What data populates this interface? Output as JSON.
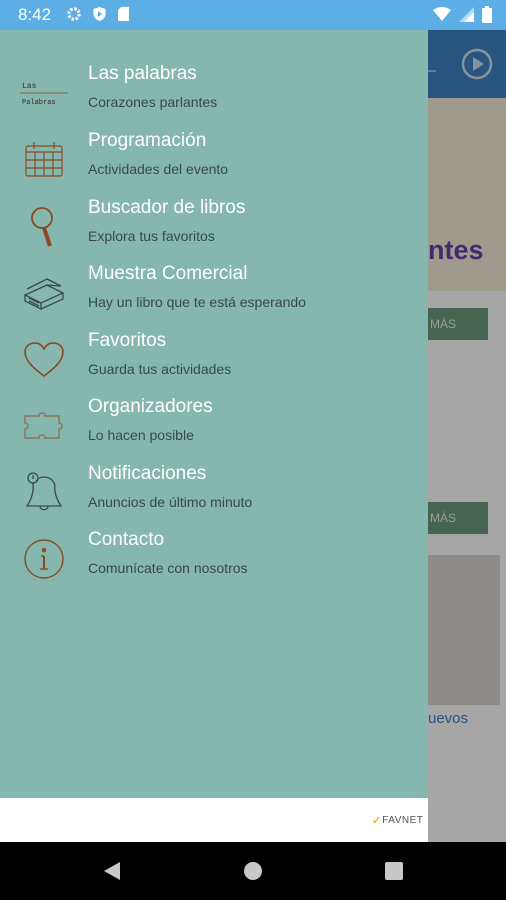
{
  "status_bar": {
    "time": "8:42",
    "left_icons": [
      "gear-icon",
      "shield-icon",
      "sd-card-icon"
    ],
    "right_icons": [
      "wifi-icon",
      "signal-icon",
      "battery-icon"
    ]
  },
  "background_screen": {
    "banner_partial_text": "ntes",
    "button_1_partial_label": "MÁS",
    "button_2_partial_label": "MÁS",
    "photo_caption_partial": "uevos"
  },
  "drawer": {
    "header_logo": {
      "line1": "Las",
      "line2": "Palabras"
    },
    "items": [
      {
        "title": "Las palabras",
        "subtitle": "Corazones parlantes",
        "icon": "las-palabras-logo-icon"
      },
      {
        "title": "Programación",
        "subtitle": "Actividades del evento",
        "icon": "calendar-icon"
      },
      {
        "title": "Buscador de libros",
        "subtitle": "Explora tus favoritos",
        "icon": "magnifier-icon"
      },
      {
        "title": "Muestra Comercial",
        "subtitle": "Hay un libro que te está esperando",
        "icon": "books-icon"
      },
      {
        "title": "Favoritos",
        "subtitle": "Guarda tus actividades",
        "icon": "heart-icon"
      },
      {
        "title": "Organizadores",
        "subtitle": "Lo hacen posible",
        "icon": "puzzle-icon"
      },
      {
        "title": "Notificaciones",
        "subtitle": "Anuncios de último minuto",
        "icon": "bell-icon"
      },
      {
        "title": "Contacto",
        "subtitle": "Comunícate con nosotros",
        "icon": "info-icon"
      }
    ],
    "footer_logo": {
      "mark": "✓",
      "name": "FAVNET"
    }
  },
  "nav_bar": {
    "buttons": [
      "back-button",
      "home-button",
      "recents-button"
    ]
  },
  "colors": {
    "status_bar": "#5eaee6",
    "drawer_bg": "#85b7ae",
    "icon_stroke": "#8a4a22",
    "header_bg": "#3f82c4",
    "nav_bar": "#000000"
  }
}
